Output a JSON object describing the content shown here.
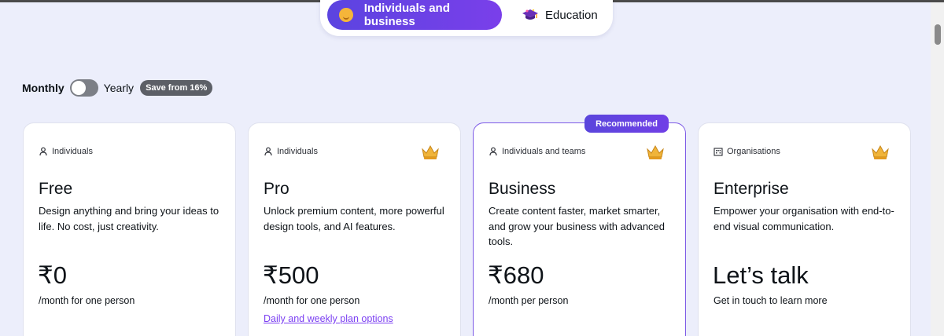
{
  "audience_tabs": [
    {
      "label": "Individuals and business",
      "icon": "smile-emoji-icon",
      "active": true
    },
    {
      "label": "Education",
      "icon": "graduation-cap-icon",
      "active": false
    }
  ],
  "billing": {
    "monthly_label": "Monthly",
    "yearly_label": "Yearly",
    "save_badge": "Save from 16%",
    "toggle_state": "monthly"
  },
  "recommended_badge": "Recommended",
  "plans": [
    {
      "audience": "Individuals",
      "audience_icon": "person-icon",
      "name": "Free",
      "description": "Design anything and bring your ideas to life. No cost, just creativity.",
      "price": "₹0",
      "period": "/month for one person",
      "link": "",
      "crown": false
    },
    {
      "audience": "Individuals",
      "audience_icon": "person-icon",
      "name": "Pro",
      "description": "Unlock premium content, more powerful design tools, and AI features.",
      "price": "₹500",
      "period": "/month for one person",
      "link": "Daily and weekly plan options",
      "crown": true
    },
    {
      "audience": "Individuals and teams",
      "audience_icon": "person-icon",
      "name": "Business",
      "description": "Create content faster, market smarter, and grow your business with advanced tools.",
      "price": "₹680",
      "period": "/month per person",
      "link": "",
      "crown": true
    },
    {
      "audience": "Organisations",
      "audience_icon": "building-icon",
      "name": "Enterprise",
      "description": "Empower your organisation with end-to-end visual communication.",
      "price": "Let’s talk",
      "period": "Get in touch to learn more",
      "link": "",
      "crown": true
    }
  ],
  "colors": {
    "accent_gradient_start": "#5b44e0",
    "accent_gradient_end": "#7a3fea",
    "page_bg": "#eceefb",
    "link": "#7b3ff2",
    "crown": "#f0b43a"
  }
}
